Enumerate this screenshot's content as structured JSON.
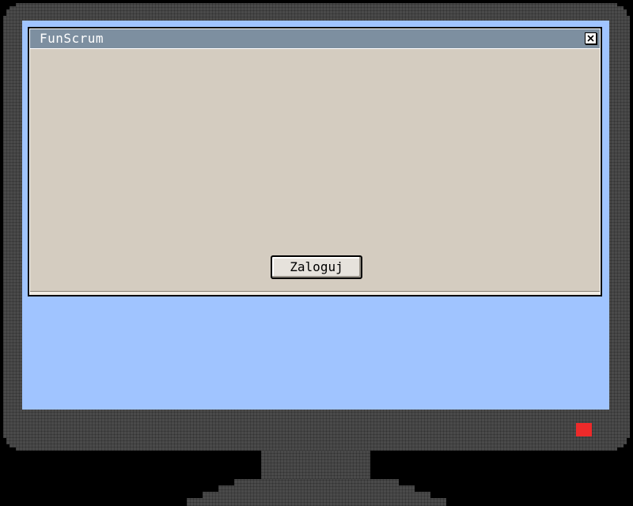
{
  "window": {
    "title": "FunScrum",
    "close_icon": "close-x-icon"
  },
  "main": {
    "login_label": "Zaloguj"
  },
  "colors": {
    "desktop": "#a0c4ff",
    "titlebar": "#7d8fa0",
    "window_body": "#d4ccc0",
    "bezel": "#4a4a4a",
    "power_led": "#ee2a2a"
  }
}
